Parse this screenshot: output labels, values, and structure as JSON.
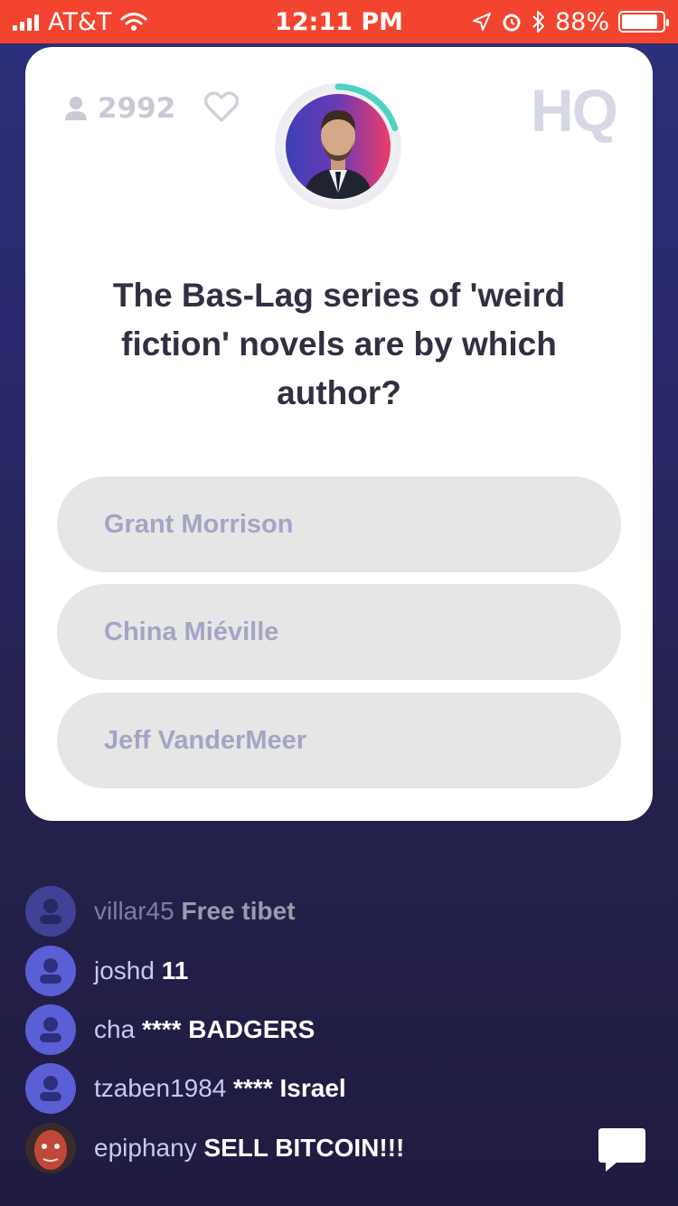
{
  "status_bar": {
    "carrier": "AT&T",
    "time": "12:11 PM",
    "battery_percent": "88%",
    "battery_level": 0.88
  },
  "card": {
    "viewer_count": "2992",
    "logo": "HQ",
    "question": "The Bas-Lag series of 'weird fiction' novels are by which author?",
    "answers": [
      "Grant Morrison",
      "China Miéville",
      "Jeff VanderMeer"
    ],
    "timer_progress": 0.2
  },
  "chat": {
    "messages": [
      {
        "user": "villar45",
        "text": "Free tibet"
      },
      {
        "user": "joshd",
        "text": "11"
      },
      {
        "user": "cha",
        "text": "**** BADGERS"
      },
      {
        "user": "tzaben1984",
        "text": "**** Israel"
      },
      {
        "user": "epiphany",
        "text": "SELL BITCOIN!!!"
      }
    ]
  },
  "colors": {
    "status_bar": "#f3442f",
    "avatar": "#5b5fd6",
    "timer_ring": "#4fd1c5"
  },
  "icons": [
    "signal-icon",
    "wifi-icon",
    "location-icon",
    "alarm-icon",
    "bluetooth-icon",
    "battery-icon",
    "person-icon",
    "heart-icon",
    "chat-bubble-icon"
  ]
}
